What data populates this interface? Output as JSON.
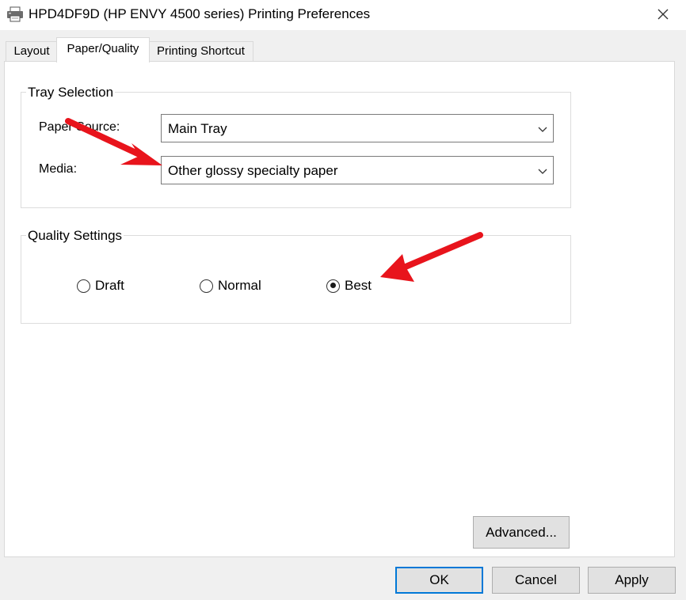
{
  "window": {
    "title": "HPD4DF9D (HP ENVY 4500 series) Printing Preferences",
    "icon": "printer-icon",
    "close_icon": "close-icon"
  },
  "tabs": [
    {
      "label": "Layout",
      "active": false
    },
    {
      "label": "Paper/Quality",
      "active": true
    },
    {
      "label": "Printing Shortcut",
      "active": false
    }
  ],
  "tray_selection": {
    "group_label": "Tray Selection",
    "paper_source": {
      "label": "Paper Source:",
      "value": "Main Tray"
    },
    "media": {
      "label": "Media:",
      "value": "Other glossy specialty paper"
    }
  },
  "quality_settings": {
    "group_label": "Quality Settings",
    "options": [
      {
        "label": "Draft",
        "checked": false
      },
      {
        "label": "Normal",
        "checked": false
      },
      {
        "label": "Best",
        "checked": true
      }
    ]
  },
  "buttons": {
    "advanced": "Advanced...",
    "ok": "OK",
    "cancel": "Cancel",
    "apply": "Apply"
  },
  "annotations": {
    "arrow_color": "#e8141c"
  },
  "colors": {
    "default_button_border": "#0078d7",
    "dialog_background": "#f0f0f0",
    "panel_background": "#ffffff"
  }
}
